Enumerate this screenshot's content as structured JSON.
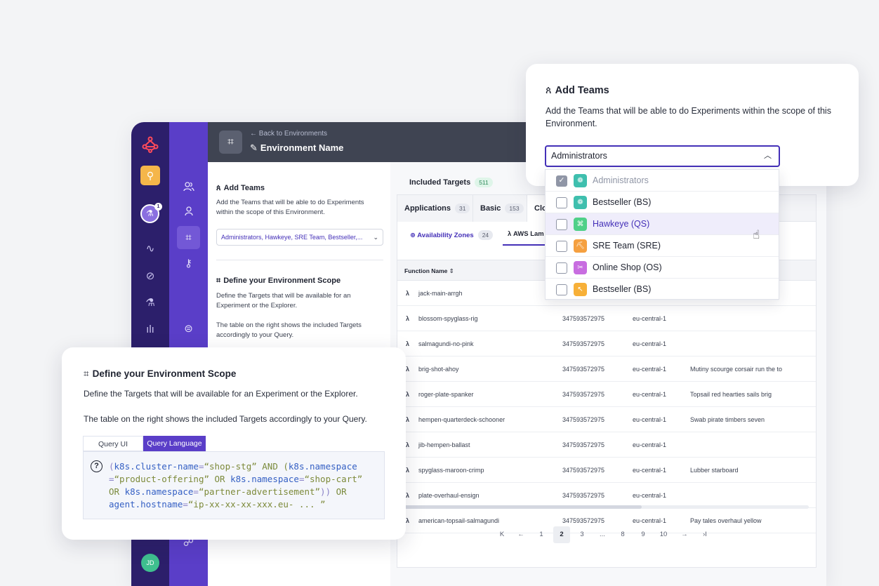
{
  "topbar": {
    "back_link": "← Back to Environments",
    "env_name": "Environment Name"
  },
  "rail": {
    "notification_count": "1",
    "user_initials": "JD"
  },
  "left_pane": {
    "teams_title": "Add Teams",
    "teams_desc": "Add the Teams that will be able to do Experiments within the scope of this Environment.",
    "teams_select_value": "Administrators, Hawkeye, SRE Team, Bestseller,...",
    "scope_title": "Define your Environment Scope",
    "scope_desc": "Define the Targets that will be available for an Experiment or the Explorer.",
    "scope_desc2": "The table on the right shows the included Targets accordingly to your Query."
  },
  "targets": {
    "title": "Included Targets",
    "count": "511",
    "tabs": [
      {
        "label": "Applications",
        "count": "31"
      },
      {
        "label": "Basic",
        "count": "153"
      },
      {
        "label": "Clo"
      }
    ],
    "subtabs": [
      {
        "label": "Availability Zones",
        "count": "24"
      },
      {
        "label": "AWS Lam"
      }
    ],
    "column_function_name": "Function Name",
    "rows": [
      {
        "name": "jack-main-arrgh",
        "account": "",
        "region": "",
        "desc": ""
      },
      {
        "name": "blossom-spyglass-rig",
        "account": "347593572975",
        "region": "eu-central-1",
        "desc": ""
      },
      {
        "name": "salmagundi-no-pink",
        "account": "347593572975",
        "region": "eu-central-1",
        "desc": ""
      },
      {
        "name": "brig-shot-ahoy",
        "account": "347593572975",
        "region": "eu-central-1",
        "desc": "Mutiny scourge corsair run the to"
      },
      {
        "name": "roger-plate-spanker",
        "account": "347593572975",
        "region": "eu-central-1",
        "desc": "Topsail red hearties sails brig"
      },
      {
        "name": "hempen-quarterdeck-schooner",
        "account": "347593572975",
        "region": "eu-central-1",
        "desc": "Swab pirate timbers seven"
      },
      {
        "name": "jib-hempen-ballast",
        "account": "347593572975",
        "region": "eu-central-1",
        "desc": ""
      },
      {
        "name": "spyglass-maroon-crimp",
        "account": "347593572975",
        "region": "eu-central-1",
        "desc": "Lubber starboard"
      },
      {
        "name": "plate-overhaul-ensign",
        "account": "347593572975",
        "region": "eu-central-1",
        "desc": ""
      },
      {
        "name": "american-topsail-salmagundi",
        "account": "347593572975",
        "region": "eu-central-1",
        "desc": "Pay tales overhaul yellow"
      }
    ],
    "pagination": [
      "K",
      "←",
      "1",
      "2",
      "3",
      "...",
      "8",
      "9",
      "10",
      "→",
      "›I"
    ]
  },
  "teams_popover": {
    "title": "Add Teams",
    "desc": "Add the Teams that will be able to do Experiments within the scope of this Environment.",
    "select_value": "Administrators",
    "options": [
      {
        "label": "Administrators",
        "checked": true,
        "color": "#3fbfae"
      },
      {
        "label": "Bestseller (BS)",
        "checked": false,
        "color": "#3fbfae"
      },
      {
        "label": "Hawkeye (QS)",
        "checked": false,
        "color": "#4fd088"
      },
      {
        "label": "SRE Team (SRE)",
        "checked": false,
        "color": "#f5a040"
      },
      {
        "label": "Online Shop (OS)",
        "checked": false,
        "color": "#c86de0"
      },
      {
        "label": "Bestseller (BS)",
        "checked": false,
        "color": "#f7b038"
      }
    ]
  },
  "scope_popover": {
    "title": "Define your Environment Scope",
    "desc": "Define the Targets that will be available for an Experiment or the Explorer.",
    "desc2": "The table on the right shows the included Targets accordingly to your Query.",
    "tab_ui": "Query UI",
    "tab_lang": "Query Language",
    "query": {
      "l1a": "(",
      "l1b": "k8s.cluster-name",
      "l1c": "=",
      "l1d": "“shop-stg”",
      "l1e": " AND (",
      "l1f": "k8s.namespace",
      "l2a": "=",
      "l2b": "“product-offering”",
      "l2c": " OR ",
      "l2d": "k8s.namespace",
      "l2e": "=",
      "l2f": "“shop-cart”",
      "l3a": "OR ",
      "l3b": "k8s.namespace",
      "l3c": "=",
      "l3d": "“partner-advertisement”",
      "l3e": "))",
      "l3f": " OR",
      "l4a": "agent.hostname",
      "l4b": "=",
      "l4c": "“ip-xx-xx-xx-xxx.eu- ... ”"
    }
  }
}
